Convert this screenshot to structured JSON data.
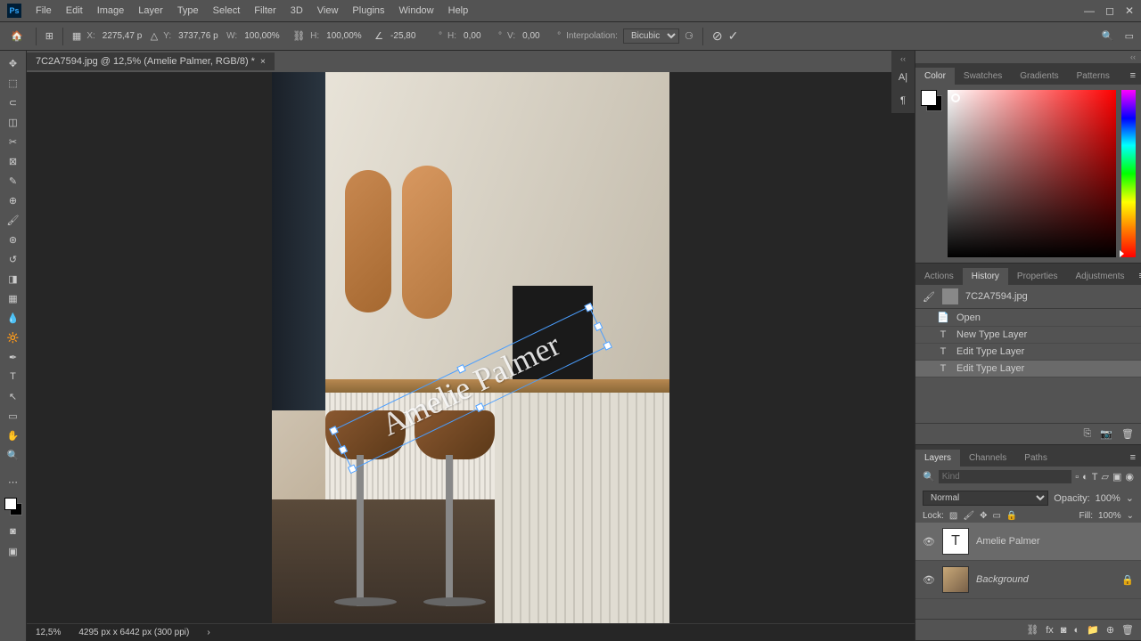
{
  "menubar": {
    "items": [
      "File",
      "Edit",
      "Image",
      "Layer",
      "Type",
      "Select",
      "Filter",
      "3D",
      "View",
      "Plugins",
      "Window",
      "Help"
    ]
  },
  "optionsbar": {
    "x_label": "X:",
    "x_value": "2275,47 p",
    "y_label": "Y:",
    "y_value": "3737,76 p",
    "w_label": "W:",
    "w_value": "100,00%",
    "h_label": "H:",
    "h_value": "100,00%",
    "angle_value": "-25,80",
    "h2_label": "H:",
    "h2_value": "0,00",
    "v_label": "V:",
    "v_value": "0,00",
    "interp_label": "Interpolation:",
    "interp_value": "Bicubic"
  },
  "document": {
    "tab_title": "7C2A7594.jpg @ 12,5% (Amelie Palmer, RGB/8) *",
    "text_content": "Amelie Palmer"
  },
  "statusbar": {
    "zoom": "12,5%",
    "dimensions": "4295 px x 6442 px (300 ppi)"
  },
  "color_panel": {
    "tabs": [
      "Color",
      "Swatches",
      "Gradients",
      "Patterns"
    ]
  },
  "history_panel": {
    "tabs": [
      "Actions",
      "History",
      "Properties",
      "Adjustments"
    ],
    "doc_name": "7C2A7594.jpg",
    "items": [
      {
        "icon": "📄",
        "label": "Open"
      },
      {
        "icon": "T",
        "label": "New Type Layer"
      },
      {
        "icon": "T",
        "label": "Edit Type Layer"
      },
      {
        "icon": "T",
        "label": "Edit Type Layer"
      }
    ]
  },
  "layers_panel": {
    "tabs": [
      "Layers",
      "Channels",
      "Paths"
    ],
    "search_placeholder": "Kind",
    "blend_mode": "Normal",
    "opacity_label": "Opacity:",
    "opacity_value": "100%",
    "lock_label": "Lock:",
    "fill_label": "Fill:",
    "fill_value": "100%",
    "layers": [
      {
        "name": "Amelie Palmer",
        "type": "text"
      },
      {
        "name": "Background",
        "type": "image"
      }
    ]
  }
}
